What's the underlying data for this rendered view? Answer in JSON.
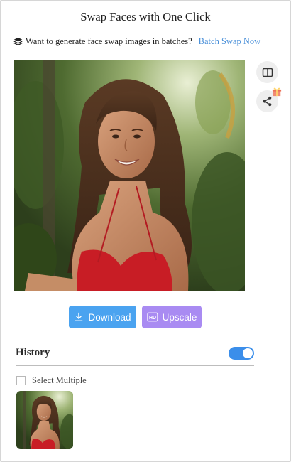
{
  "header": {
    "title": "Swap Faces with One Click",
    "batch_prompt": "Want to generate face swap images in batches?",
    "batch_link": "Batch Swap Now"
  },
  "result": {
    "image_alt": "Face swap result: smiling woman with long wavy hair in a red top, jungle background"
  },
  "side_buttons": {
    "compare_icon": "compare-split-icon",
    "share_icon": "share-icon",
    "gift_icon": "gift-icon"
  },
  "actions": {
    "download_label": "Download",
    "upscale_label": "Upscale",
    "upscale_badge": "HD"
  },
  "history": {
    "title": "History",
    "toggle_on": true,
    "select_multiple_label": "Select Multiple",
    "thumbnails": [
      {
        "alt": "History thumbnail of face swap result"
      }
    ]
  },
  "colors": {
    "accent_blue": "#4aa3f0",
    "accent_purple": "#a98bf2",
    "toggle_blue": "#3b8eea",
    "link_blue": "#4a90d9"
  }
}
